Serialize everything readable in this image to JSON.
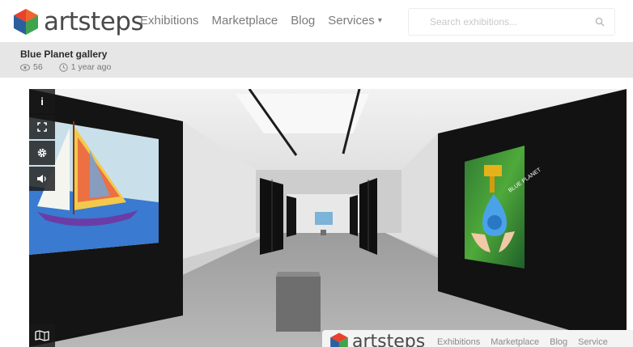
{
  "brand": {
    "name": "artsteps"
  },
  "nav": {
    "items": [
      "Exhibitions",
      "Marketplace",
      "Blog",
      "Services"
    ],
    "services_caret": "▾"
  },
  "search": {
    "placeholder": "Search exhibitions..."
  },
  "gallery": {
    "title": "Blue Planet gallery",
    "views": "56",
    "age": "1 year ago"
  },
  "viewer": {
    "controls": [
      "i"
    ],
    "painting_left": "sailboat",
    "painting_right": "BLUE PLANET"
  },
  "overlay": {
    "brand": "artsteps",
    "nav": [
      "Exhibitions",
      "Marketplace",
      "Blog",
      "Service"
    ]
  },
  "colors": {
    "brand_red": "#e8412c",
    "brand_blue": "#2d5f9e",
    "brand_green": "#3fa34d",
    "strip": "#e6e6e6",
    "wall_dark": "#151515"
  }
}
